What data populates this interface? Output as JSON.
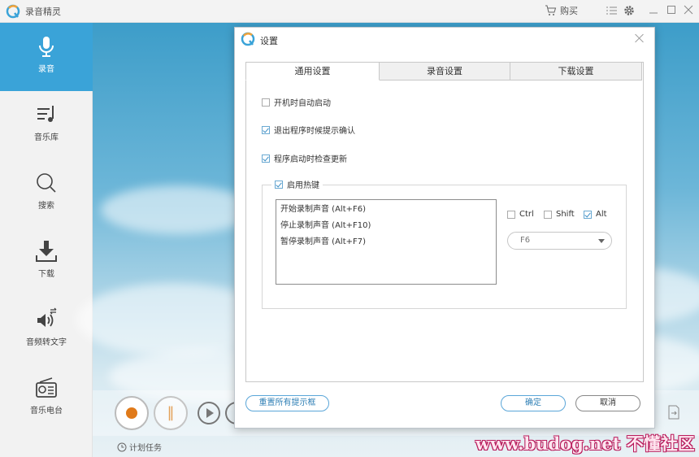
{
  "app": {
    "title": "录音精灵",
    "buy_label": "购买"
  },
  "sidebar": {
    "items": [
      {
        "label": "录音",
        "icon": "microphone-icon",
        "active": true
      },
      {
        "label": "音乐库",
        "icon": "music-library-icon"
      },
      {
        "label": "搜索",
        "icon": "search-icon"
      },
      {
        "label": "下载",
        "icon": "download-icon"
      },
      {
        "label": "音频转文字",
        "icon": "speech-to-text-icon"
      },
      {
        "label": "音乐电台",
        "icon": "radio-icon"
      }
    ]
  },
  "player": {
    "schedule_label": "计划任务"
  },
  "dialog": {
    "title": "设置",
    "tabs": [
      {
        "label": "通用设置",
        "active": true
      },
      {
        "label": "录音设置"
      },
      {
        "label": "下载设置"
      }
    ],
    "options": {
      "autostart": {
        "label": "开机时自动启动",
        "checked": false
      },
      "exit_confirm": {
        "label": "退出程序时候提示确认",
        "checked": true
      },
      "check_update": {
        "label": "程序启动时检查更新",
        "checked": true
      }
    },
    "hotkeys": {
      "enable_label": "启用热键",
      "enabled": true,
      "list": [
        "开始录制声音 (Alt+F6)",
        "停止录制声音 (Alt+F10)",
        "暂停录制声音 (Alt+F7)"
      ],
      "modifiers": {
        "ctrl": {
          "label": "Ctrl",
          "checked": false
        },
        "shift": {
          "label": "Shift",
          "checked": false
        },
        "alt": {
          "label": "Alt",
          "checked": true
        }
      },
      "key_value": "F6"
    },
    "buttons": {
      "reset": "重置所有提示框",
      "ok": "确定",
      "cancel": "取消"
    }
  },
  "watermark": "www.budog.net 不懂社区",
  "colors": {
    "accent": "#3aa3d8",
    "record": "#e07a1a"
  }
}
